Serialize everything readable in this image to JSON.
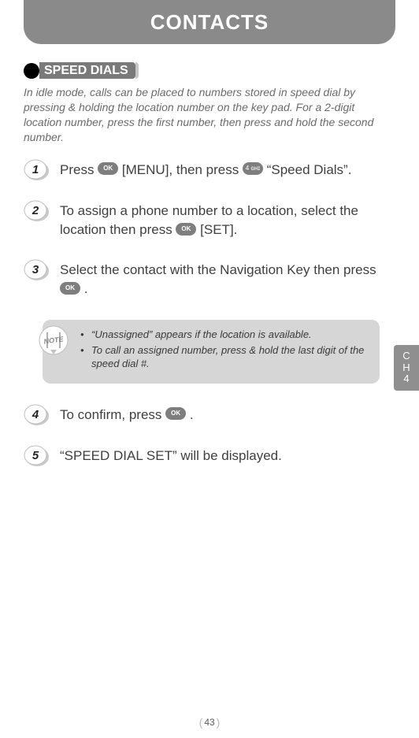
{
  "header": {
    "title": "CONTACTS"
  },
  "section": {
    "label": "SPEED DIALS"
  },
  "intro": "In idle mode, calls can be placed to numbers stored in speed dial by pressing & holding the location number on the key pad. For a 2-digit location number, press the first number, then press and hold the second number.",
  "steps": {
    "s1": {
      "pre": "Press ",
      "mid": " [MENU], then press ",
      "post": " “Speed Dials”."
    },
    "s2": {
      "pre": "To assign a phone number to a location, select the location then press ",
      "post": " [SET]."
    },
    "s3": {
      "pre": "Select the contact with the Navigation Key then press ",
      "post": " ."
    },
    "s4": {
      "pre": "To confirm, press ",
      "post": " ."
    },
    "s5": {
      "text": "“SPEED DIAL SET” will be displayed."
    }
  },
  "buttons": {
    "ok": "OK",
    "key4": "4 ɢʜɪ"
  },
  "note": {
    "items": [
      "“Unassigned” appears if the location is available.",
      "To call an assigned number, press & hold the last digit of the speed dial #."
    ]
  },
  "sideTab": {
    "line1": "C",
    "line2": "H",
    "line3": "4"
  },
  "page": {
    "number": "43"
  }
}
